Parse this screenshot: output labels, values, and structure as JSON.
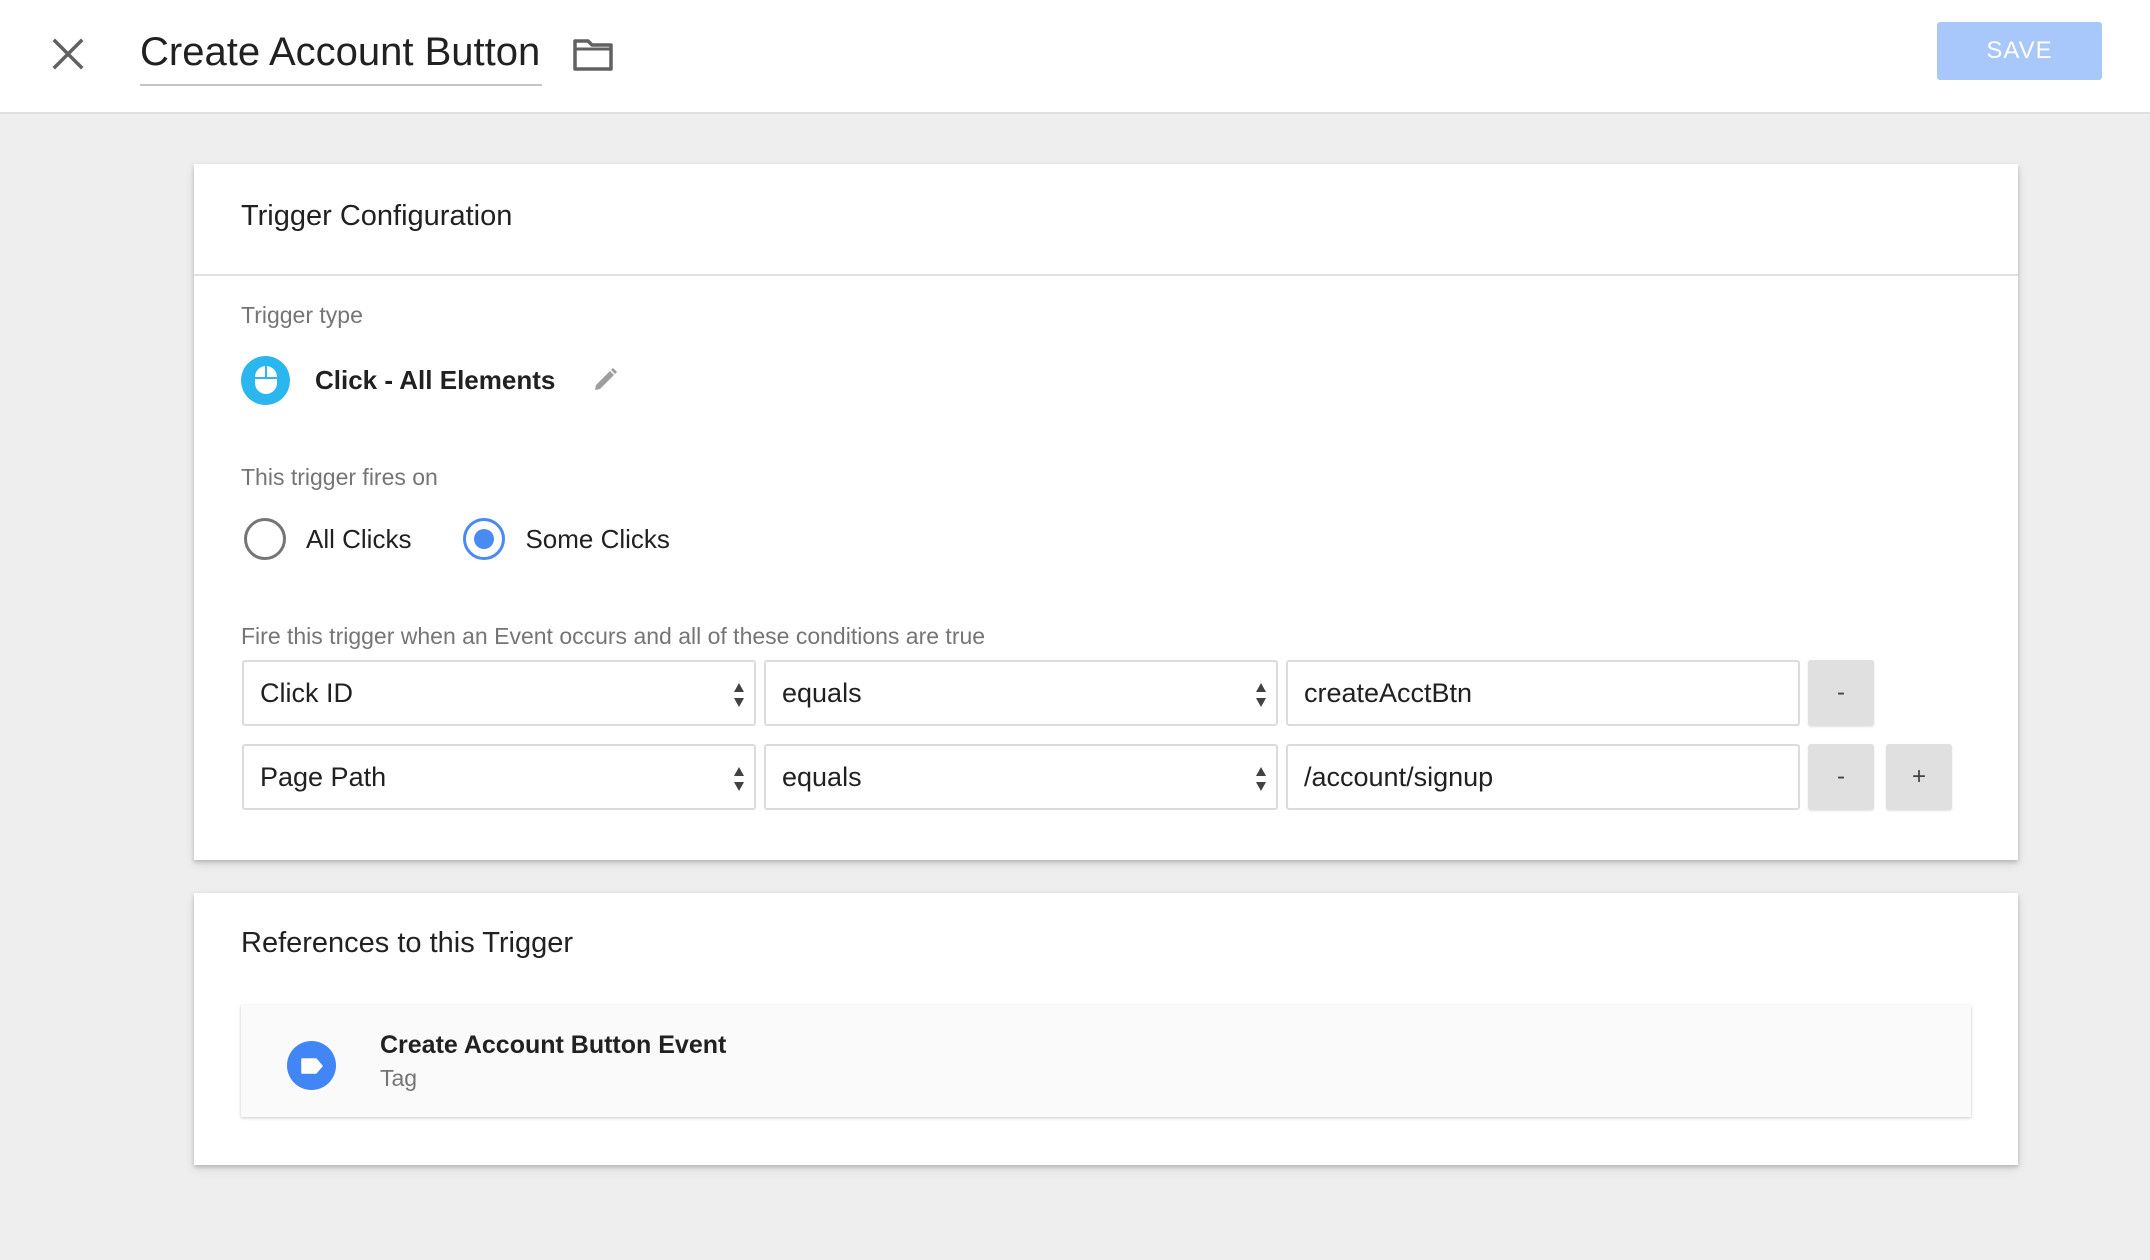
{
  "header": {
    "title": "Create Account Button",
    "save_label": "SAVE",
    "close_icon": "close-icon",
    "folder_icon": "folder-icon"
  },
  "trigger_config": {
    "title": "Trigger Configuration",
    "trigger_type_label": "Trigger type",
    "trigger_type_name": "Click - All Elements",
    "trigger_type_icon": "mouse-icon",
    "fires_on_label": "This trigger fires on",
    "options": [
      {
        "label": "All Clicks",
        "selected": false
      },
      {
        "label": "Some Clicks",
        "selected": true
      }
    ],
    "conditions_label": "Fire this trigger when an Event occurs and all of these conditions are true",
    "conditions": [
      {
        "variable": "Click ID",
        "operator": "equals",
        "value": "createAcctBtn",
        "remove_label": "-"
      },
      {
        "variable": "Page Path",
        "operator": "equals",
        "value": "/account/signup",
        "remove_label": "-",
        "add_label": "+"
      }
    ]
  },
  "references": {
    "title": "References to this Trigger",
    "items": [
      {
        "name": "Create Account Button Event",
        "type": "Tag",
        "icon": "tag-icon"
      }
    ]
  },
  "colors": {
    "accent": "#4a8af4",
    "save_disabled": "#a8c7fa",
    "trigger_icon_bg": "#2cb6f0",
    "tag_icon_bg": "#4285f4",
    "page_bg": "#eeeeee"
  }
}
